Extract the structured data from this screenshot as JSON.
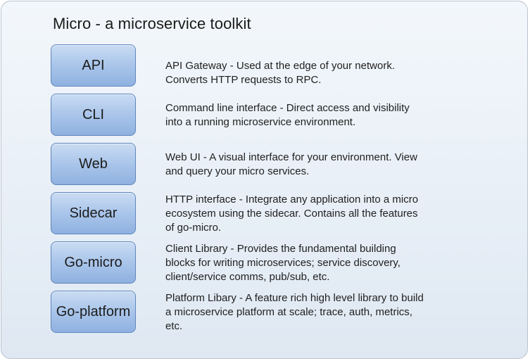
{
  "title": "Micro - a microservice toolkit",
  "components": [
    {
      "label": "API",
      "lines": [
        "API Gateway - Used at the edge of your network.",
        "Converts HTTP requests to RPC."
      ]
    },
    {
      "label": "CLI",
      "lines": [
        "Command line interface - Direct access and visibility",
        "into a running microservice environment."
      ]
    },
    {
      "label": "Web",
      "lines": [
        "Web UI - A visual interface for your environment. View",
        "and query your micro services."
      ]
    },
    {
      "label": "Sidecar",
      "lines": [
        "HTTP interface - Integrate any application into a micro",
        "ecosystem using the sidecar. Contains all the features",
        "of go-micro."
      ]
    },
    {
      "label": "Go-micro",
      "lines": [
        "Client Library - Provides the fundamental building",
        "blocks for writing microservices; service discovery,",
        "client/service comms, pub/sub, etc."
      ]
    },
    {
      "label": "Go-platform",
      "lines": [
        "Platform Libary - A feature rich high level library to build",
        "a microservice platform at scale; trace, auth, metrics,",
        "etc."
      ]
    }
  ]
}
